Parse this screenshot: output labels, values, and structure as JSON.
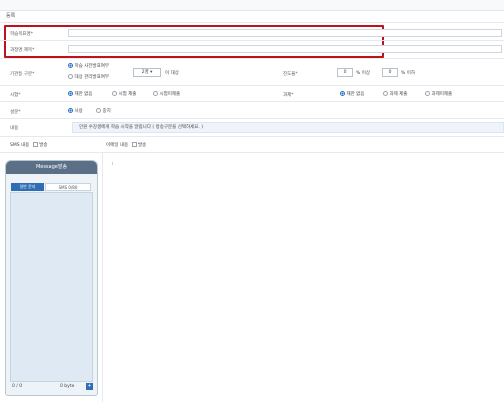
{
  "header": {
    "title": "등록"
  },
  "form": {
    "field1": {
      "label": "학습목표명*",
      "value": ""
    },
    "field2": {
      "label": "과정명 제목*",
      "value": ""
    },
    "type_row": {
      "label": "기관등 구분*",
      "options": [
        "학습 사전발표여부",
        "대상 관리발표여부"
      ],
      "select_value": "2명",
      "select_suffix": "이 대상",
      "right_label": "진도율*",
      "right_prefix": "0",
      "right_mid": "% 이상",
      "right_prefix2": "0",
      "right_suffix": "% 이하"
    },
    "row3": {
      "label": "시험*",
      "options": [
        "제한 없음",
        "시험 제출",
        "시험미제출"
      ],
      "right_label": "과제*",
      "right_options": [
        "제한 없음",
        "과제 제출",
        "과제미제출"
      ]
    },
    "row4": {
      "label": "설문*",
      "options": [
        "사용",
        "중지"
      ]
    },
    "row5": {
      "label": "내용",
      "notice": "인원 수강생에게 학습 시작을 알림니다 ( 방송구분을 선택하세요. )"
    },
    "row6": {
      "sms_label": "SMS 내용",
      "sms_check": "발송",
      "email_label": "이메일 내용",
      "email_check": "발송"
    }
  },
  "phone_panel": {
    "title": "Message발송",
    "tab_active": "일반 문자",
    "tab_inactive": "SMS 0/80",
    "footer_left": "0 / 0",
    "footer_right": "0 byte",
    "footer_btn": "+"
  },
  "colors": {
    "accent": "#2f6db4",
    "highlight": "#c0121e"
  }
}
